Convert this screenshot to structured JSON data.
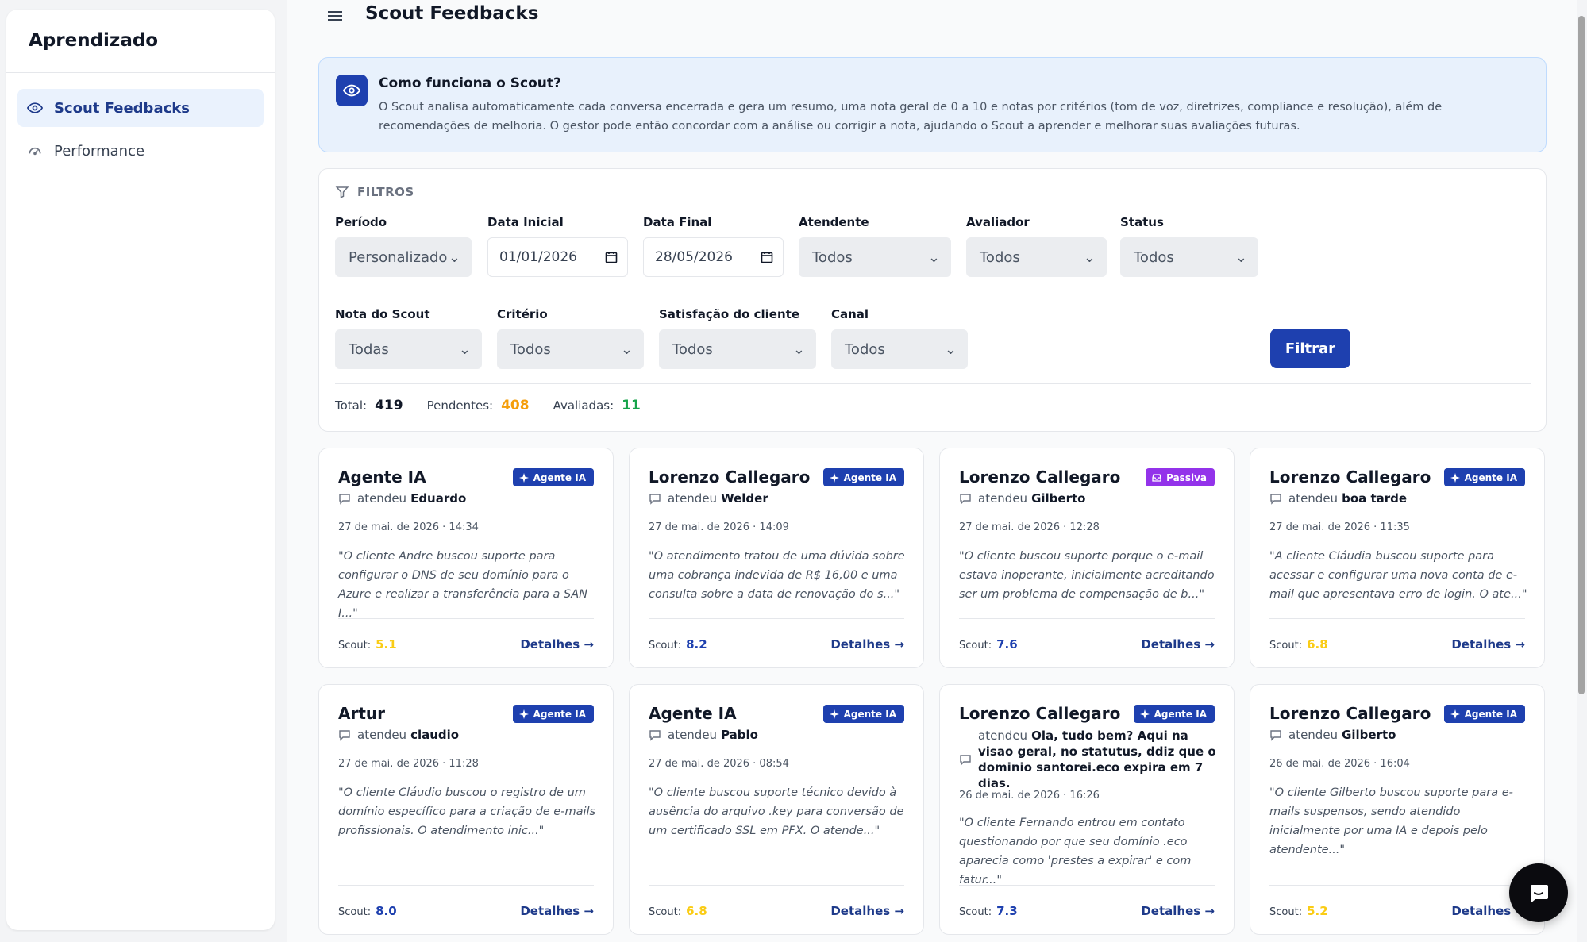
{
  "sidebar": {
    "title": "Aprendizado",
    "items": [
      {
        "label": "Scout Feedbacks",
        "icon": "eye-icon",
        "active": true
      },
      {
        "label": "Performance",
        "icon": "gauge-icon",
        "active": false
      }
    ]
  },
  "header": {
    "title": "Scout Feedbacks"
  },
  "info": {
    "title": "Como funciona o Scout?",
    "text": "O Scout analisa automaticamente cada conversa encerrada e gera um resumo, uma nota geral de 0 a 10 e notas por critérios (tom de voz, diretrizes, compliance e resolução), além de recomendações de melhoria. O gestor pode então concordar com a análise ou corrigir a nota, ajudando o Scout a aprender e melhorar suas avaliações futuras."
  },
  "filters": {
    "heading": "FILTROS",
    "periodo": {
      "label": "Período",
      "value": "Personalizado"
    },
    "data_inicial": {
      "label": "Data Inicial",
      "value": "01/01/2026"
    },
    "data_final": {
      "label": "Data Final",
      "value": "28/05/2026"
    },
    "atendente": {
      "label": "Atendente",
      "value": "Todos"
    },
    "avaliador": {
      "label": "Avaliador",
      "value": "Todos"
    },
    "status": {
      "label": "Status",
      "value": "Todos"
    },
    "nota": {
      "label": "Nota do Scout",
      "value": "Todas"
    },
    "criterio": {
      "label": "Critério",
      "value": "Todos"
    },
    "satisfacao": {
      "label": "Satisfação do cliente",
      "value": "Todos"
    },
    "canal": {
      "label": "Canal",
      "value": "Todos"
    },
    "button": "Filtrar"
  },
  "stats": {
    "total_label": "Total:",
    "total": "419",
    "pendentes_label": "Pendentes:",
    "pendentes": "408",
    "avaliadas_label": "Avaliadas:",
    "avaliadas": "11"
  },
  "colors": {
    "primary": "#1e40af",
    "pending": "#f59e0b",
    "evaluated": "#16a34a",
    "passive": "#9333ea",
    "score_low": "#facc15",
    "score_high": "#1e40af"
  },
  "cards": [
    {
      "name": "Agente IA",
      "badge": "Agente IA",
      "attended_prefix": "atendeu",
      "customer": "Eduardo",
      "date": "27 de mai. de 2026 · 14:34",
      "summary": "\"O cliente Andre buscou suporte para configurar o DNS de seu domínio para o Azure e realizar a transferência para a SAN I...\"",
      "score_label": "Scout:",
      "score": "5.1",
      "details": "Detalhes →"
    },
    {
      "name": "Lorenzo Callegaro",
      "badge": "Agente IA",
      "attended_prefix": "atendeu",
      "customer": "Welder",
      "date": "27 de mai. de 2026 · 14:09",
      "summary": "\"O atendimento tratou de uma dúvida sobre uma cobrança indevida de R$ 16,00 e uma consulta sobre a data de renovação do s...\"",
      "score_label": "Scout:",
      "score": "8.2",
      "details": "Detalhes →"
    },
    {
      "name": "Lorenzo Callegaro",
      "badge": "Passiva",
      "attended_prefix": "atendeu",
      "customer": "Gilberto",
      "date": "27 de mai. de 2026 · 12:28",
      "summary": "\"O cliente buscou suporte porque o e-mail estava inoperante, inicialmente acreditando ser um problema de compensação de b...\"",
      "score_label": "Scout:",
      "score": "7.6",
      "details": "Detalhes →"
    },
    {
      "name": "Lorenzo Callegaro",
      "badge": "Agente IA",
      "attended_prefix": "atendeu",
      "customer": "boa tarde",
      "date": "27 de mai. de 2026 · 11:35",
      "summary": "\"A cliente Cláudia buscou suporte para acessar e configurar uma nova conta de e-mail que apresentava erro de login. O ate...\"",
      "score_label": "Scout:",
      "score": "6.8",
      "details": "Detalhes →"
    },
    {
      "name": "Artur",
      "badge": "Agente IA",
      "attended_prefix": "atendeu",
      "customer": "claudio",
      "date": "27 de mai. de 2026 · 11:28",
      "summary": "\"O cliente Cláudio buscou o registro de um domínio específico para a criação de e-mails profissionais. O atendimento inic...\"",
      "score_label": "Scout:",
      "score": "8.0",
      "details": "Detalhes →"
    },
    {
      "name": "Agente IA",
      "badge": "Agente IA",
      "attended_prefix": "atendeu",
      "customer": "Pablo",
      "date": "27 de mai. de 2026 · 08:54",
      "summary": "\"O cliente buscou suporte técnico devido à ausência do arquivo .key para conversão de um certificado SSL em PFX. O atende...\"",
      "score_label": "Scout:",
      "score": "6.8",
      "details": "Detalhes →"
    },
    {
      "name": "Lorenzo Callegaro",
      "badge": "Agente IA",
      "attended_prefix": "atendeu",
      "customer": "Ola, tudo bem? Aqui na visao geral, no statutus, ddiz que o dominio santorei.eco expira em 7 dias.",
      "date": "26 de mai. de 2026 · 16:26",
      "summary": "\"O cliente Fernando entrou em contato questionando por que seu domínio .eco aparecia como 'prestes a expirar' e com fatur...\"",
      "score_label": "Scout:",
      "score": "7.3",
      "details": "Detalhes →"
    },
    {
      "name": "Lorenzo Callegaro",
      "badge": "Agente IA",
      "attended_prefix": "atendeu",
      "customer": "Gilberto",
      "date": "26 de mai. de 2026 · 16:04",
      "summary": "\"O cliente Gilberto buscou suporte para e-mails suspensos, sendo atendido inicialmente por uma IA e depois pelo atendente...\"",
      "score_label": "Scout:",
      "score": "5.2",
      "details": "Detalhes →"
    }
  ]
}
